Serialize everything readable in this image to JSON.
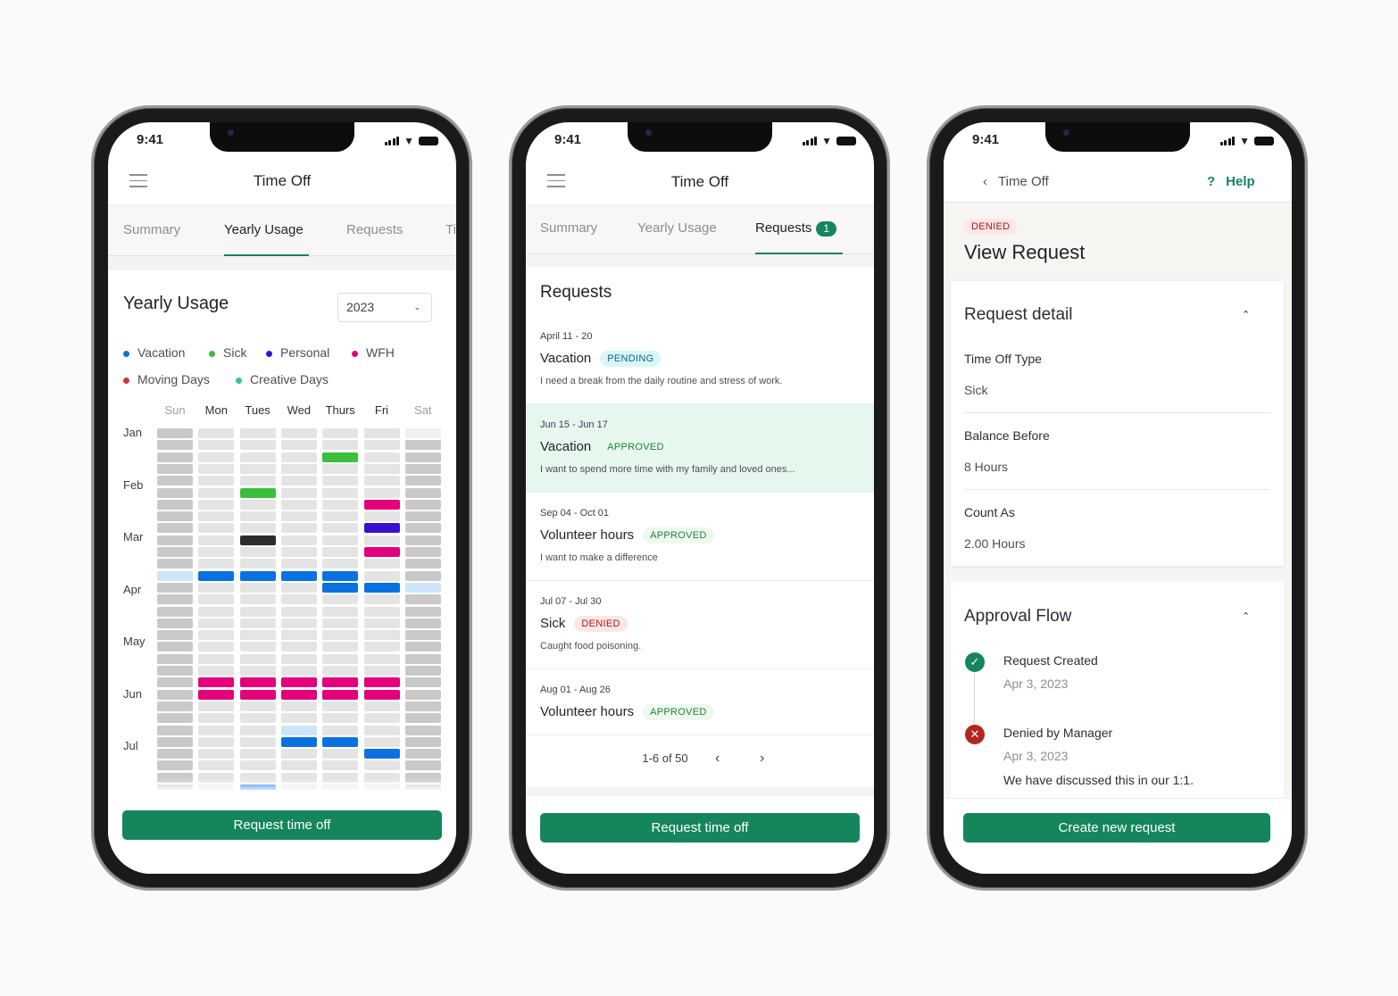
{
  "status_time": "9:41",
  "colors": {
    "accent": "#15855c",
    "vacation": "#0a72e0",
    "sick": "#3ac03a",
    "personal": "#3b0fcf",
    "wfh": "#e3007a",
    "moving": "#c7373b",
    "creative": "#2ec4a8",
    "other": "#2a2c30",
    "highlight": "#cde5fb",
    "weekday_empty": "#e4e4e4",
    "weekend_empty": "#c9c9c9"
  },
  "screen1": {
    "header_title": "Time Off",
    "menu_icon": "hamburger-icon",
    "tabs": [
      {
        "label": "Summary"
      },
      {
        "label": "Yearly Usage",
        "active": true
      },
      {
        "label": "Requests"
      },
      {
        "label": "Ti"
      }
    ],
    "heading": "Yearly Usage",
    "year_select": "2023",
    "legend": [
      {
        "label": "Vacation",
        "color": "#0a72e0"
      },
      {
        "label": "Sick",
        "color": "#3ac03a"
      },
      {
        "label": "Personal",
        "color": "#3b0fcf"
      },
      {
        "label": "WFH",
        "color": "#e3007a"
      },
      {
        "label": "Moving Days",
        "color": "#c7373b"
      },
      {
        "label": "Creative Days",
        "color": "#2ec4a8"
      }
    ],
    "days": [
      "Sun",
      "Mon",
      "Tues",
      "Wed",
      "Thurs",
      "Fri",
      "Sat"
    ],
    "months": [
      "Jan",
      "Feb",
      "Mar",
      "Apr",
      "May",
      "Jun",
      "Jul"
    ],
    "week_count": 31,
    "marked_days": [
      {
        "week": 2,
        "day": 4,
        "type": "sick"
      },
      {
        "week": 5,
        "day": 2,
        "type": "sick"
      },
      {
        "week": 6,
        "day": 5,
        "type": "wfh"
      },
      {
        "week": 8,
        "day": 5,
        "type": "personal"
      },
      {
        "week": 9,
        "day": 2,
        "type": "other"
      },
      {
        "week": 10,
        "day": 5,
        "type": "wfh"
      },
      {
        "week": 12,
        "day": 0,
        "type": "highlight"
      },
      {
        "week": 12,
        "day": 1,
        "type": "vacation"
      },
      {
        "week": 12,
        "day": 2,
        "type": "vacation"
      },
      {
        "week": 12,
        "day": 3,
        "type": "vacation"
      },
      {
        "week": 12,
        "day": 4,
        "type": "vacation"
      },
      {
        "week": 13,
        "day": 4,
        "type": "vacation"
      },
      {
        "week": 13,
        "day": 5,
        "type": "vacation"
      },
      {
        "week": 13,
        "day": 6,
        "type": "highlight"
      },
      {
        "week": 21,
        "day": 1,
        "type": "wfh"
      },
      {
        "week": 21,
        "day": 2,
        "type": "wfh"
      },
      {
        "week": 21,
        "day": 3,
        "type": "wfh"
      },
      {
        "week": 21,
        "day": 4,
        "type": "wfh"
      },
      {
        "week": 21,
        "day": 5,
        "type": "wfh"
      },
      {
        "week": 22,
        "day": 1,
        "type": "wfh"
      },
      {
        "week": 22,
        "day": 2,
        "type": "wfh"
      },
      {
        "week": 22,
        "day": 3,
        "type": "wfh"
      },
      {
        "week": 22,
        "day": 4,
        "type": "wfh"
      },
      {
        "week": 22,
        "day": 5,
        "type": "wfh"
      },
      {
        "week": 25,
        "day": 3,
        "type": "highlight"
      },
      {
        "week": 26,
        "day": 3,
        "type": "vacation"
      },
      {
        "week": 26,
        "day": 4,
        "type": "vacation"
      },
      {
        "week": 27,
        "day": 5,
        "type": "vacation"
      },
      {
        "week": 30,
        "day": 2,
        "type": "vacation"
      }
    ],
    "button": "Request time off"
  },
  "screen2": {
    "header_title": "Time Off",
    "tabs": [
      {
        "label": "Summary"
      },
      {
        "label": "Yearly Usage"
      },
      {
        "label": "Requests",
        "active": true,
        "count": "1"
      }
    ],
    "heading": "Requests",
    "requests": [
      {
        "date": "April 11 - 20",
        "type": "Vacation",
        "status": "PENDING",
        "status_class": "pending",
        "note": "I need a break from the daily routine and stress of work."
      },
      {
        "date": "Jun 15 - Jun 17",
        "type": "Vacation",
        "status": "APPROVED",
        "status_class": "approved",
        "note": "I want to spend more time with my family and loved ones...",
        "selected": true
      },
      {
        "date": "Sep 04 - Oct 01",
        "type": "Volunteer hours",
        "status": "APPROVED",
        "status_class": "approved",
        "note": "I want to make a difference"
      },
      {
        "date": "Jul 07 - Jul 30",
        "type": "Sick",
        "status": "DENIED",
        "status_class": "denied",
        "note": "Caught food poisoning."
      },
      {
        "date": "Aug 01 - Aug 26",
        "type": "Volunteer hours",
        "status": "APPROVED",
        "status_class": "approved",
        "note": ""
      }
    ],
    "pagination": "1-6 of 50",
    "button": "Request time off"
  },
  "screen3": {
    "back_label": "Time Off",
    "help_label": "Help",
    "status_badge": "DENIED",
    "title": "View Request",
    "detail_heading": "Request detail",
    "fields": [
      {
        "label": "Time Off Type",
        "value": "Sick"
      },
      {
        "label": "Balance Before",
        "value": "8 Hours"
      },
      {
        "label": "Count As",
        "value": "2.00 Hours"
      }
    ],
    "approval_heading": "Approval Flow",
    "steps": [
      {
        "title": "Request Created",
        "date": "Apr 3, 2023",
        "state": "done"
      },
      {
        "title": "Denied by Manager",
        "date": "Apr 3, 2023",
        "state": "denied",
        "note": "We have discussed this in our 1:1."
      }
    ],
    "button": "Create new request"
  }
}
